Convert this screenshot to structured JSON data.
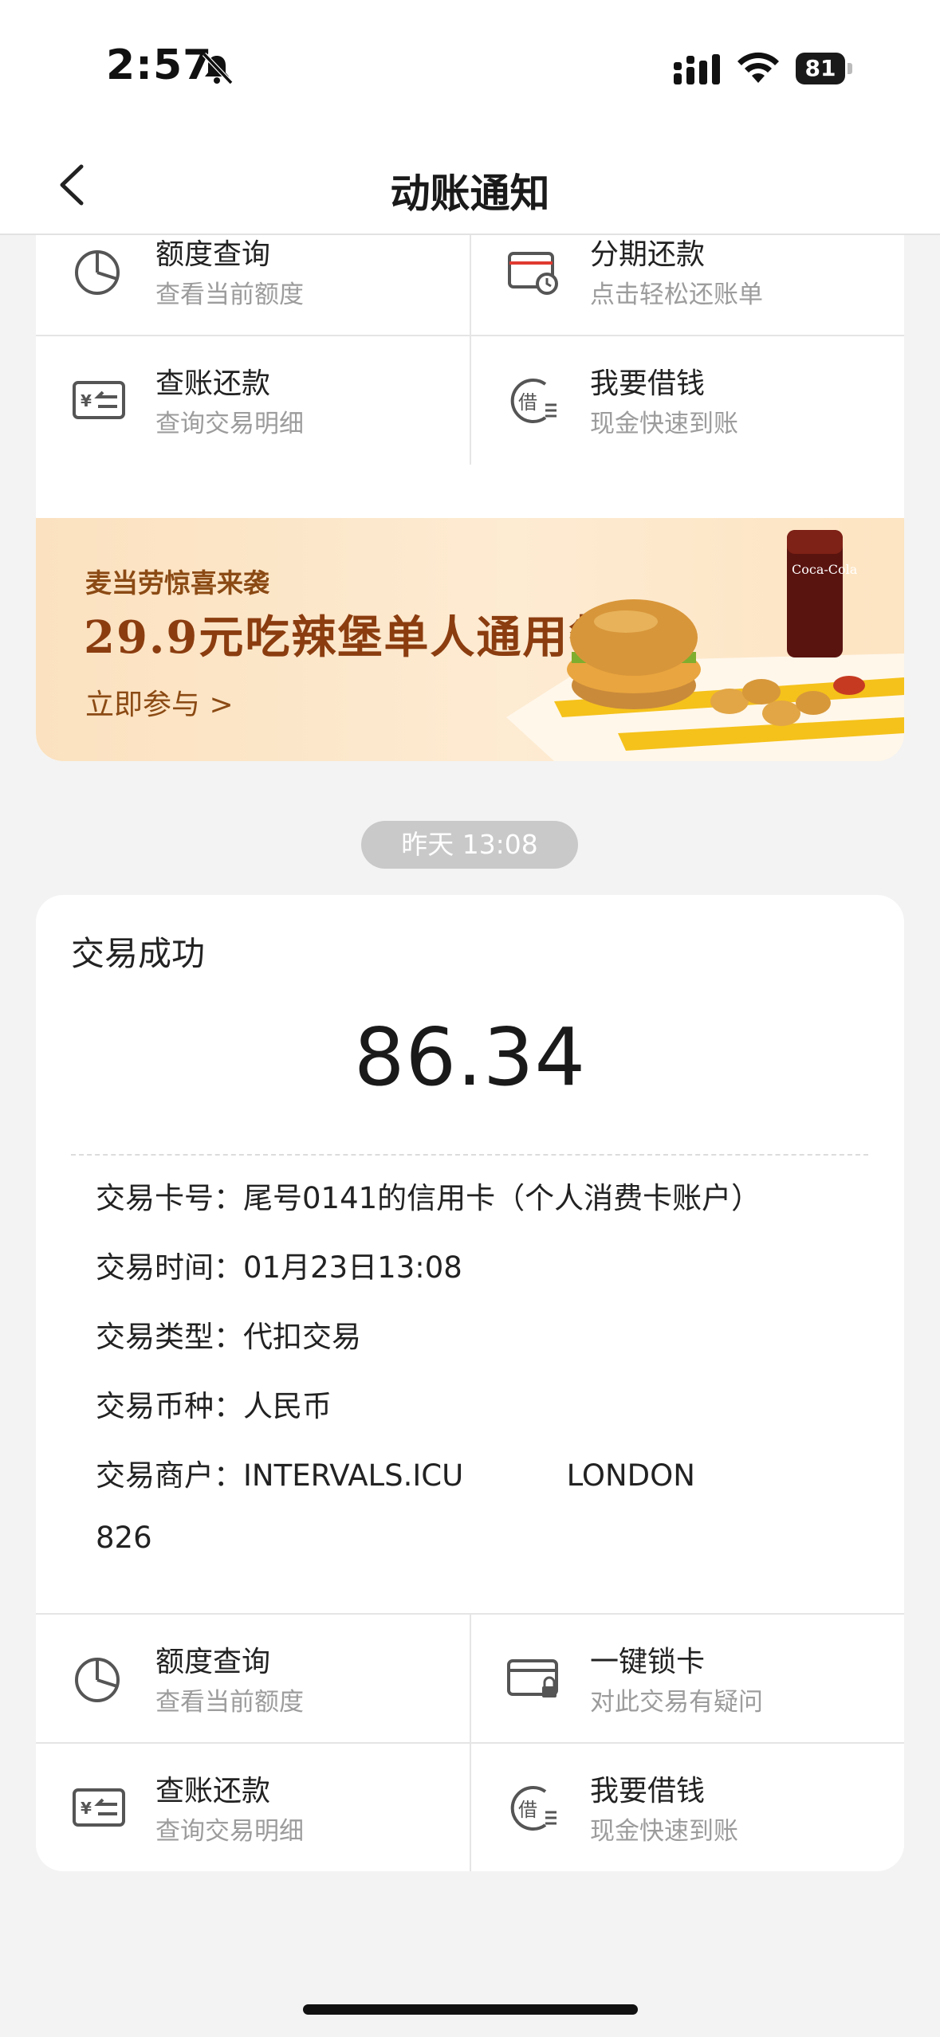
{
  "status_bar": {
    "time": "2:57",
    "battery": "81"
  },
  "nav": {
    "title": "动账通知"
  },
  "top_actions": [
    {
      "title": "额度查询",
      "subtitle": "查看当前额度",
      "icon": "pie-chart-icon"
    },
    {
      "title": "分期还款",
      "subtitle": "点击轻松还账单",
      "icon": "card-clock-icon"
    },
    {
      "title": "查账还款",
      "subtitle": "查询交易明细",
      "icon": "yen-card-icon"
    },
    {
      "title": "我要借钱",
      "subtitle": "现金快速到账",
      "icon": "borrow-icon"
    }
  ],
  "banner": {
    "subtitle": "麦当劳惊喜来袭",
    "headline": "29.9元吃辣堡单人通用餐!",
    "cta": "立即参与 >"
  },
  "timestamp": "昨天 13:08",
  "transaction": {
    "status": "交易成功",
    "amount": "86.34",
    "details": [
      {
        "label": "交易卡号：",
        "value": "尾号0141的信用卡（个人消费卡账户）"
      },
      {
        "label": "交易时间：",
        "value": "01月23日13:08"
      },
      {
        "label": "交易类型：",
        "value": "代扣交易"
      },
      {
        "label": "交易币种：",
        "value": "人民币"
      },
      {
        "label": "交易商户：",
        "value": "INTERVALS.ICU           LONDON"
      }
    ],
    "merchant_line2": "826"
  },
  "bottom_actions": [
    {
      "title": "额度查询",
      "subtitle": "查看当前额度",
      "icon": "pie-chart-icon"
    },
    {
      "title": "一键锁卡",
      "subtitle": "对此交易有疑问",
      "icon": "card-lock-icon"
    },
    {
      "title": "查账还款",
      "subtitle": "查询交易明细",
      "icon": "yen-card-icon"
    },
    {
      "title": "我要借钱",
      "subtitle": "现金快速到账",
      "icon": "borrow-icon"
    }
  ],
  "colors": {
    "accent": "#e03a2f",
    "banner_text": "#8b3d10",
    "icon_gray": "#555555"
  }
}
